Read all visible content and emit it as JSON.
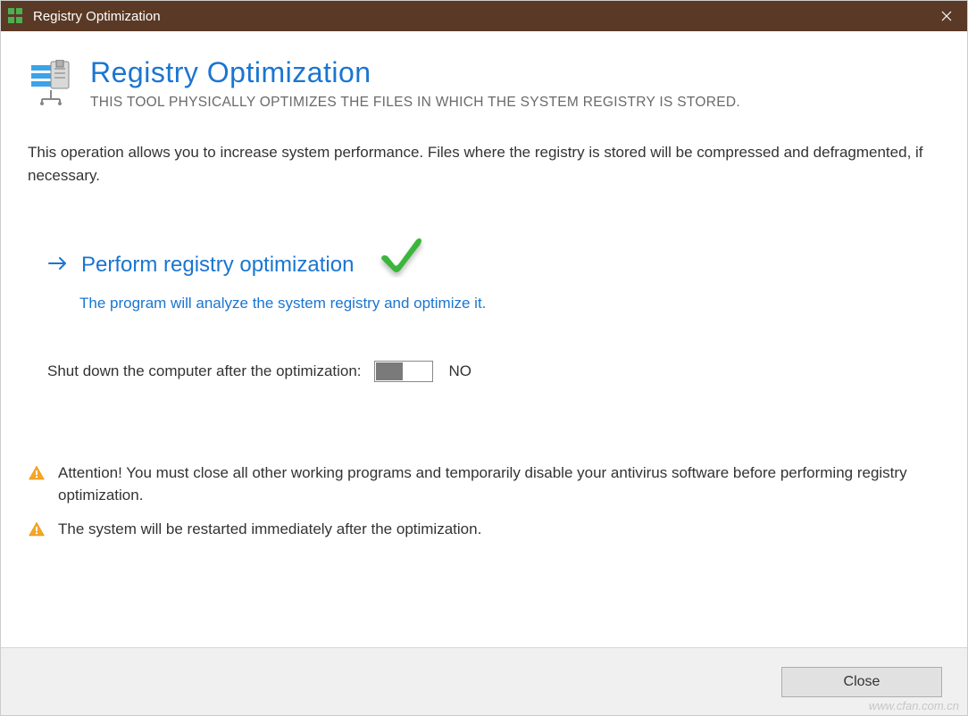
{
  "titlebar": {
    "title": "Registry Optimization"
  },
  "header": {
    "title": "Registry Optimization",
    "subtitle": "THIS TOOL PHYSICALLY OPTIMIZES THE FILES IN WHICH THE SYSTEM REGISTRY IS STORED."
  },
  "description": "This operation allows you to increase system performance. Files where the registry is stored will be compressed and defragmented, if necessary.",
  "action": {
    "title": "Perform registry optimization",
    "subtitle": "The program will analyze the system registry and optimize it."
  },
  "shutdown": {
    "label": "Shut down the computer after the optimization:",
    "state": "NO"
  },
  "warnings": [
    "Attention! You must close all other working programs and temporarily disable your antivirus software before performing registry optimization.",
    "The system will be restarted immediately after the optimization."
  ],
  "footer": {
    "close_label": "Close"
  },
  "watermark": "www.cfan.com.cn"
}
